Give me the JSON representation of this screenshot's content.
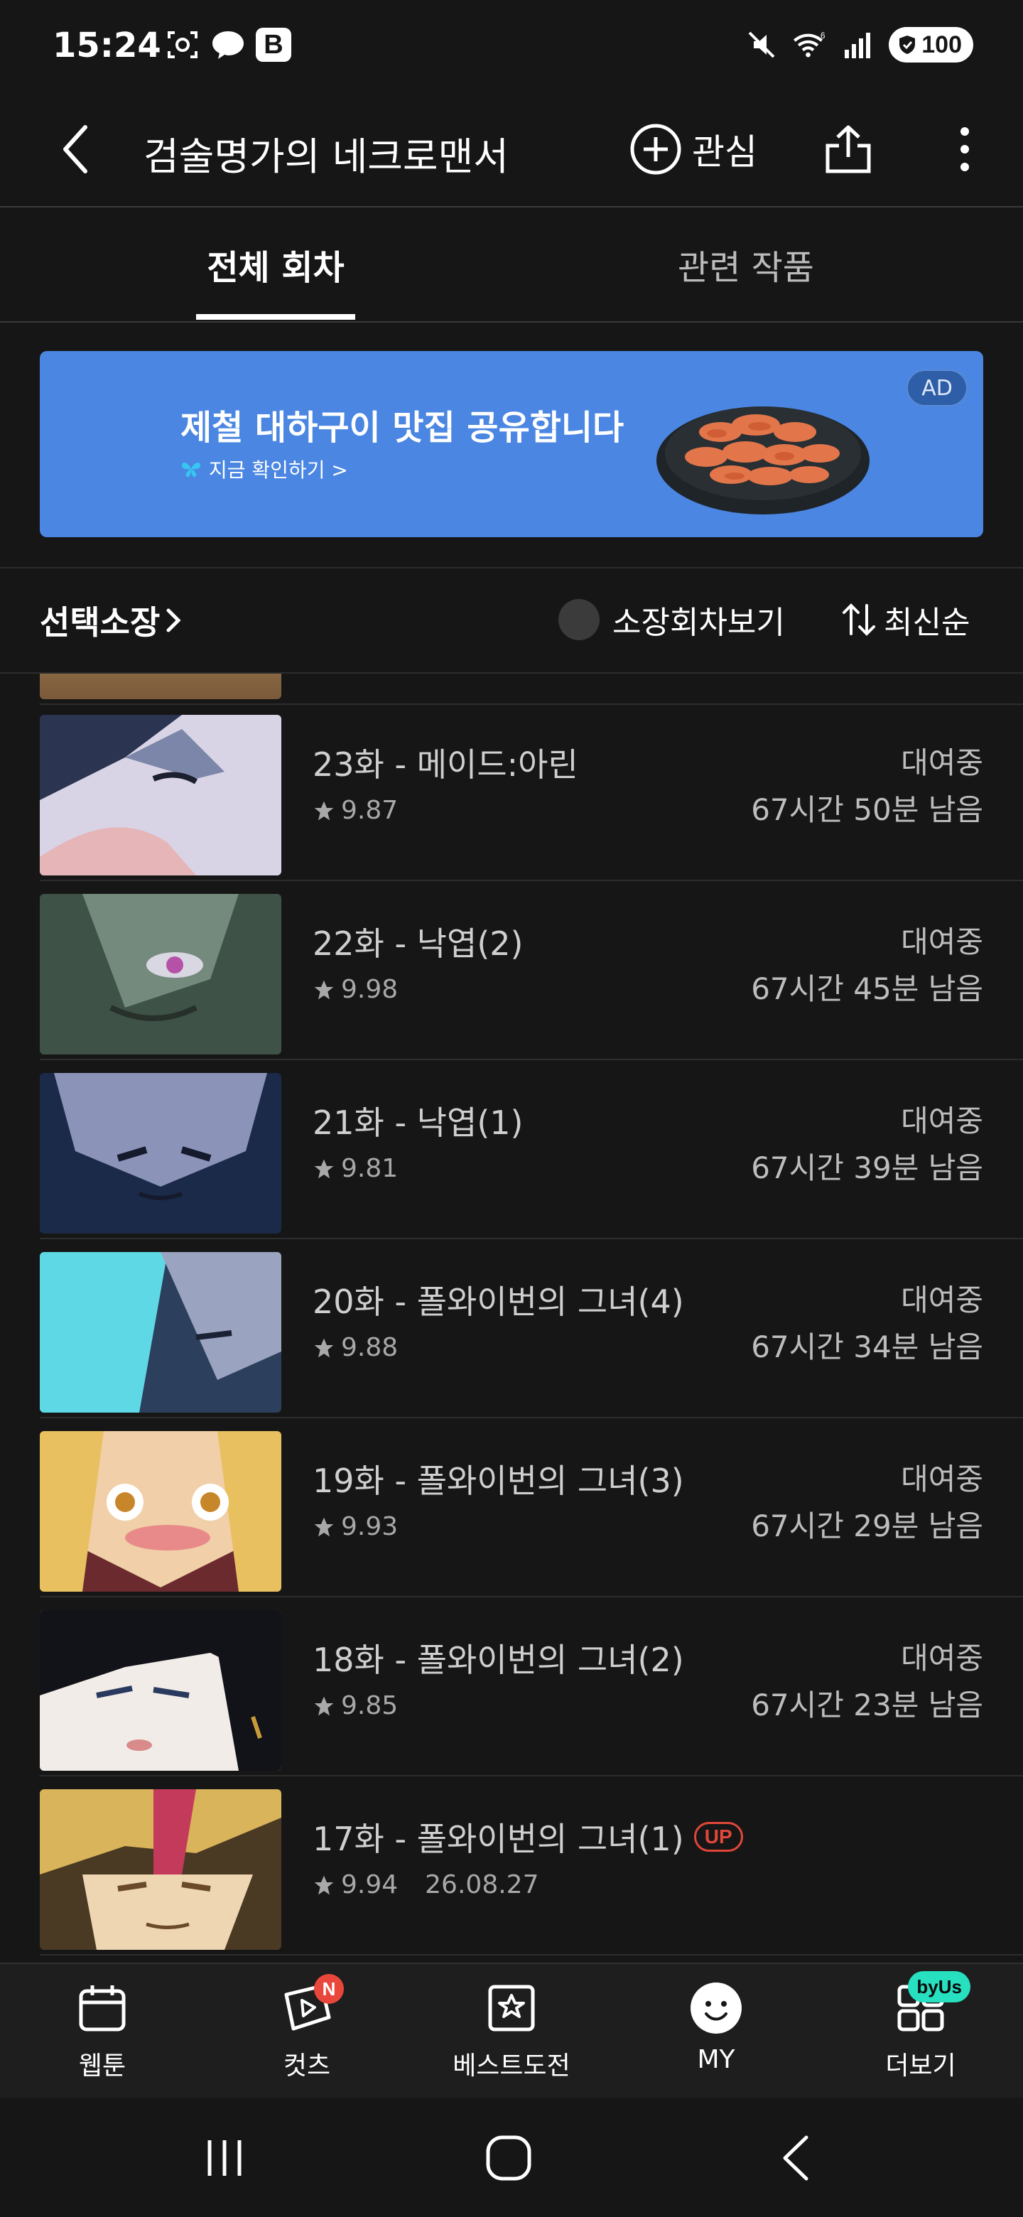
{
  "status_bar": {
    "time": "15:24",
    "battery": "100",
    "b_badge": "B",
    "wifi_badge": "6",
    "icons": [
      "screenshot-icon",
      "chat-icon",
      "b-app-icon",
      "mute-icon",
      "wifi-icon",
      "signal-icon",
      "battery-icon"
    ]
  },
  "header": {
    "title": "검술명가의 네크로맨서",
    "favorite_label": "관심"
  },
  "tabs": [
    {
      "label": "전체 회차",
      "active": true
    },
    {
      "label": "관련 작품",
      "active": false
    }
  ],
  "ad": {
    "headline": "제철 대하구이 맛집 공유합니다",
    "sub": "지금 확인하기 >",
    "badge": "AD",
    "bg_color": "#4a86e2"
  },
  "filters": {
    "select_own": "선택소장",
    "own_toggle": "소장회차보기",
    "sort": "최신순"
  },
  "episodes": [
    {
      "title": "23화 - 메이드:아린",
      "rating": "9.87",
      "status": "대여중",
      "remaining": "67시간 50분 남음"
    },
    {
      "title": "22화 - 낙엽(2)",
      "rating": "9.98",
      "status": "대여중",
      "remaining": "67시간 45분 남음"
    },
    {
      "title": "21화 - 낙엽(1)",
      "rating": "9.81",
      "status": "대여중",
      "remaining": "67시간 39분 남음"
    },
    {
      "title": "20화 - 폴와이번의 그녀(4)",
      "rating": "9.88",
      "status": "대여중",
      "remaining": "67시간 34분 남음"
    },
    {
      "title": "19화 - 폴와이번의 그녀(3)",
      "rating": "9.93",
      "status": "대여중",
      "remaining": "67시간 29분 남음"
    },
    {
      "title": "18화 - 폴와이번의 그녀(2)",
      "rating": "9.85",
      "status": "대여중",
      "remaining": "67시간 23분 남음"
    },
    {
      "title": "17화 - 폴와이번의 그녀(1)",
      "rating": "9.94",
      "date": "26.08.27",
      "badge": "UP"
    }
  ],
  "bottom_nav": [
    {
      "label": "웹툰",
      "icon": "calendar-icon"
    },
    {
      "label": "컷츠",
      "icon": "play-tag-icon",
      "badge": "N"
    },
    {
      "label": "베스트도전",
      "icon": "star-box-icon"
    },
    {
      "label": "MY",
      "icon": "smiley-icon"
    },
    {
      "label": "더보기",
      "icon": "grid-icon",
      "badge": "byUs"
    }
  ],
  "colors": {
    "background": "#161616",
    "accent_red": "#e0473a",
    "byus_teal": "#27e0c0"
  }
}
